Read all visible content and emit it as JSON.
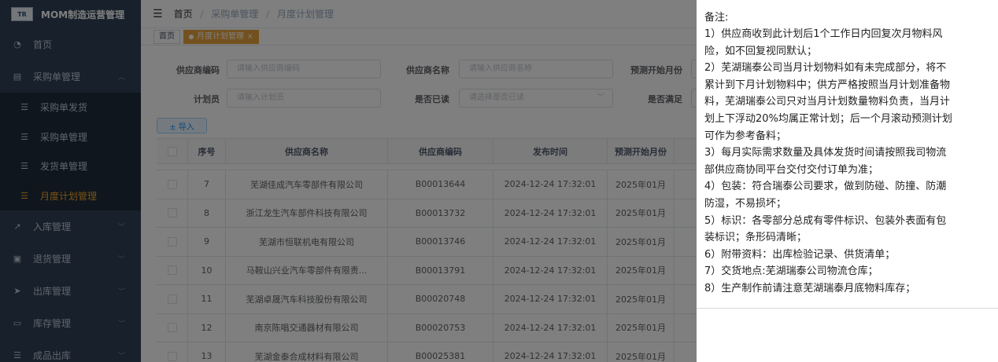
{
  "sidebar": {
    "logo_text": "TR",
    "title": "MOM制造运营管理",
    "items": [
      {
        "icon": "dashboard-icon",
        "glyph": "◔",
        "label": "首页"
      },
      {
        "icon": "cart-icon",
        "glyph": "▤",
        "label": "采购单管理"
      },
      {
        "icon": "inbound-icon",
        "glyph": "↗",
        "label": "入库管理"
      },
      {
        "icon": "return-icon",
        "glyph": "▣",
        "label": "退货管理"
      },
      {
        "icon": "send-icon",
        "glyph": "➤",
        "label": "出库管理"
      },
      {
        "icon": "inventory-icon",
        "glyph": "▭",
        "label": "库存管理"
      },
      {
        "icon": "list-icon",
        "glyph": "☰",
        "label": "成品出库"
      }
    ],
    "subitems": [
      {
        "glyph": "☰",
        "label": "采购单发货"
      },
      {
        "glyph": "☰",
        "label": "采购单管理"
      },
      {
        "glyph": "☰",
        "label": "发货单管理"
      },
      {
        "glyph": "☰",
        "label": "月度计划管理"
      }
    ],
    "active_color": "#f5a623"
  },
  "topbar": {
    "breadcrumb": [
      "首页",
      "采购单管理",
      "月度计划管理"
    ],
    "separator": "/"
  },
  "tags": {
    "home": "首页",
    "active": "月度计划管理",
    "close": "×"
  },
  "filters": {
    "supplier_code_label": "供应商编码",
    "supplier_code_placeholder": "请输入供应商编码",
    "supplier_name_label": "供应商名称",
    "supplier_name_placeholder": "请输入供应商名称",
    "forecast_month_label": "预测开始月份",
    "planner_label": "计划员",
    "planner_placeholder": "请输入计划员",
    "read_label": "是否已读",
    "read_placeholder": "请选择是否已读",
    "satisfied_label": "是否满足"
  },
  "actions": {
    "import_label": "± 导入"
  },
  "table": {
    "headers": [
      "序号",
      "供应商名称",
      "供应商编码",
      "发布时间",
      "预测开始月份"
    ],
    "rows": [
      {
        "idx": "7",
        "name": "芜湖佳成汽车零部件有限公司",
        "code": "B00013644",
        "time": "2024-12-24 17:32:01",
        "month": "2025年01月"
      },
      {
        "idx": "8",
        "name": "浙江龙生汽车部件科技有限公司",
        "code": "B00013732",
        "time": "2024-12-24 17:32:01",
        "month": "2025年01月"
      },
      {
        "idx": "9",
        "name": "芜湖市恒联机电有限公司",
        "code": "B00013746",
        "time": "2024-12-24 17:32:01",
        "month": "2025年01月"
      },
      {
        "idx": "10",
        "name": "马鞍山兴业汽车零部件有限责...",
        "code": "B00013791",
        "time": "2024-12-24 17:32:01",
        "month": "2025年01月"
      },
      {
        "idx": "11",
        "name": "芜湖卓晟汽车科技股份有限公司",
        "code": "B00020748",
        "time": "2024-12-24 17:32:01",
        "month": "2025年01月"
      },
      {
        "idx": "12",
        "name": "南京陈唱交通器材有限公司",
        "code": "B00020753",
        "time": "2024-12-24 17:32:01",
        "month": "2025年01月"
      },
      {
        "idx": "13",
        "name": "芜湖金泰合成材料有限公司",
        "code": "B00025381",
        "time": "2024-12-24 17:32:01",
        "month": "2025年01月"
      }
    ]
  },
  "notes": {
    "title": "备注:",
    "lines": [
      "1）供应商收到此计划后1个工作日内回复次月物料风",
      "险，如不回复视同默认；",
      "2）芜湖瑞泰公司当月计划物料如有未完成部分，将不",
      "累计到下月计划物料中；供方严格按照当月计划准备物",
      "料，芜湖瑞泰公司只对当月计划数量物料负责，当月计",
      "划上下浮动20%均属正常计划；后一个月滚动预测计划",
      "可作为参考备料；",
      "3）每月实际需求数量及具体发货时间请按照我司物流",
      "部供应商协同平台交付交付订单为准；",
      "4）包装：符合瑞泰公司要求，做到防碰、防撞、防潮",
      "防湿，不易损坏；",
      "5）标识：各零部分总成有零件标识、包装外表面有包",
      "装标识；条形码清晰；",
      "6）附带资料：出库检验记录、供货清单；",
      "7）交货地点:芜湖瑞泰公司物流仓库；",
      "8）生产制作前请注意芜湖瑞泰月底物料库存；"
    ]
  }
}
